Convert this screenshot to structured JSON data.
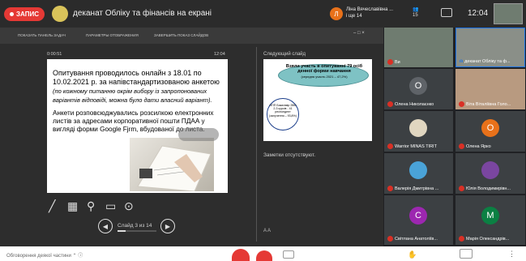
{
  "topbar": {
    "record_label": "ЗАПИС",
    "meeting_title": "деканат Обліку та фінансів на екрані",
    "presenter_initial": "Л",
    "presenter_name": "Ліна Вячеславівна ...",
    "presenter_extra": "і ще 14",
    "viewers_count": "15",
    "clock": "12:04"
  },
  "presentation": {
    "toolbar_items": [
      "ПОКАЗАТЬ ПАНЕЛЬ ЗАДАЧ",
      "ПАРАМЕТРЫ ОТОБРАЖЕНИЯ",
      "ЗАВЕРШИТЬ ПОКАЗ СЛАЙДОВ"
    ],
    "window_controls": "–  □  ×",
    "timer": "0:00:51",
    "clock": "12:04",
    "slide": {
      "text1_main": "Опитування проводилось онлайн з 18.01 по 10.02.2021 р. за напівстандартизованою анкетою",
      "text1_note": "(по кожному питанню окрім вибору із запропонованих варіантів відповіді, можна було дати власний варіант).",
      "text2": "Анкети розповсюджувались розсилкою електронних листів за адресами корпоративної пошти ПДАА у вигляді форми Google Fjrm, вбудованої до листа."
    },
    "slide_counter": "Слайд 3 из 14",
    "next_slide_label": "Следующий слайд",
    "next_slide": {
      "title": "Взяли участь в опитуванні 79 осіб денної форми навчання",
      "subtitle": "(середня участь 2021 – 47,2%)",
      "box_text": "ОПП Бакалавр ЗВО 2-3 курсів - 41 респондент (залучення – 93,8%)"
    },
    "notes": "Заметки отсутствуют.",
    "font_control": "A  A"
  },
  "participants": [
    {
      "name": "Ви",
      "initial": "",
      "color": "#6f7c70",
      "video": true
    },
    {
      "name": "деканат Обліку та ф...",
      "initial": "",
      "color": "#8a8f88",
      "video": true,
      "presenting": true
    },
    {
      "name": "Олена Николаєнко",
      "initial": "O",
      "color": "#5f6368"
    },
    {
      "name": "Віта Віталіївна Голо...",
      "initial": "",
      "color": "#c9a589",
      "video": true
    },
    {
      "name": "Warrior MINAS TIRIT",
      "initial": "",
      "color": "#e0d6c0"
    },
    {
      "name": "Олена Ярко",
      "initial": "O",
      "color": "#e8711a"
    },
    {
      "name": "Валерія Дмитрівна ...",
      "initial": "",
      "color": "#4aa3d8"
    },
    {
      "name": "Юлія Володимирівн...",
      "initial": "",
      "color": "#7a46a0"
    },
    {
      "name": "Світлана Анатоліїв...",
      "initial": "С",
      "color": "#9c27b0"
    },
    {
      "name": "Марія Олександрів...",
      "initial": "M",
      "color": "#0b8043"
    }
  ],
  "bottombar": {
    "left_text": "Обговорення деякої частини  ⌃  ⓘ",
    "hand_icon": "✋",
    "more_icon": "⋮"
  },
  "colors": {
    "record": "#e53935",
    "dark_bg": "#2d2d2d",
    "panel_bg": "#202124",
    "teal": "#7ec2c4"
  }
}
